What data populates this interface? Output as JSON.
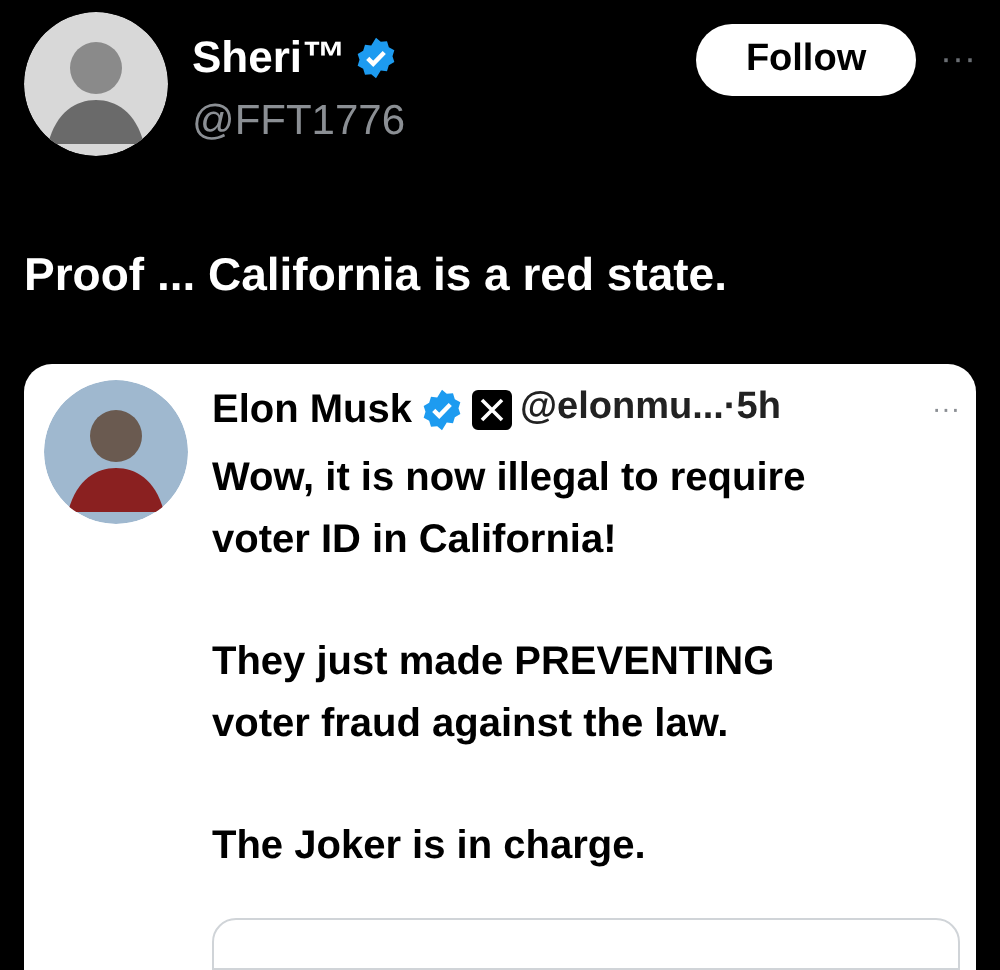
{
  "author": {
    "name": "Sheri™",
    "handle": "@FFT1776",
    "verified": true
  },
  "follow_button": "Follow",
  "more": "···",
  "text": "Proof ... California is a red state.",
  "quoted": {
    "name": "Elon Musk",
    "verified": true,
    "meta": "@elonmu...·5h",
    "more": "···",
    "paragraphs": [
      "Wow, it is now illegal to require\nvoter ID in California!",
      "They just made PREVENTING\nvoter fraud against the law.",
      "The Joker is in charge."
    ]
  }
}
